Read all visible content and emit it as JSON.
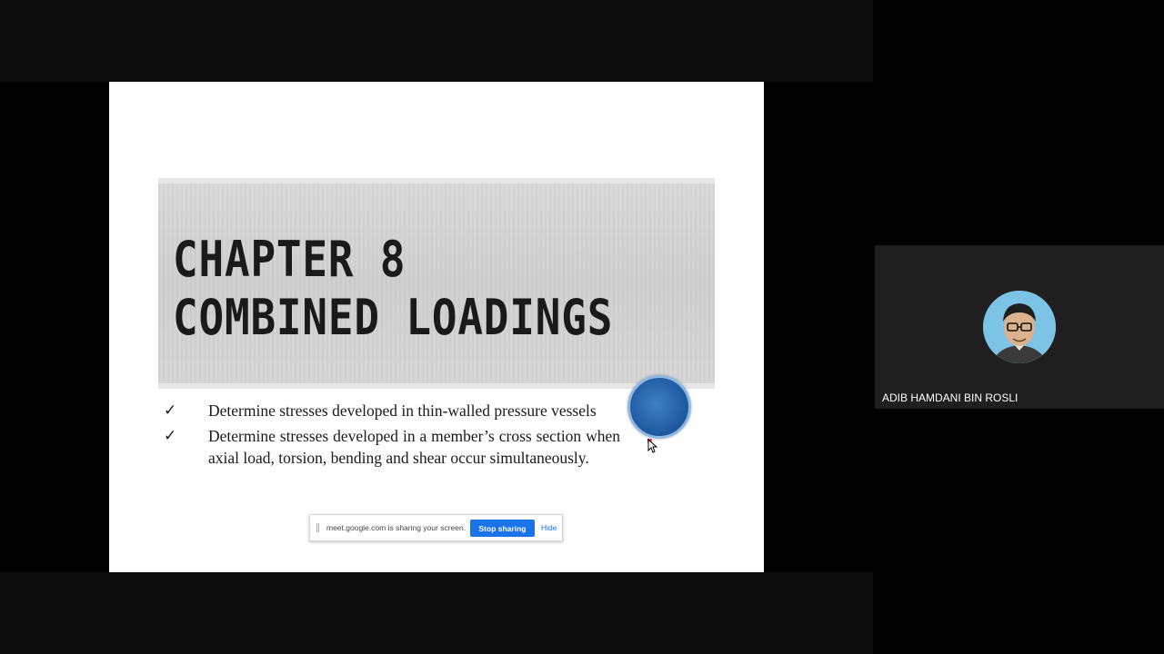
{
  "slide": {
    "title_line1": "CHAPTER 8",
    "title_line2": "COMBINED LOADINGS",
    "bullets": [
      {
        "check": "✓",
        "text": "Determine stresses developed in thin-walled pressure vessels"
      },
      {
        "check": "✓",
        "text": "Determine stresses developed in a member’s cross section when axial load, torsion, bending and shear occur simultaneously."
      }
    ]
  },
  "share_bar": {
    "message": "meet.google.com is sharing your screen.",
    "stop_label": "Stop sharing",
    "hide_label": "Hide"
  },
  "participant": {
    "name": "ADIB HAMDANI BIN ROSLI"
  },
  "colors": {
    "accent_blue": "#1a73e8",
    "background": "#000000",
    "tile_background": "#1f1f1f"
  }
}
